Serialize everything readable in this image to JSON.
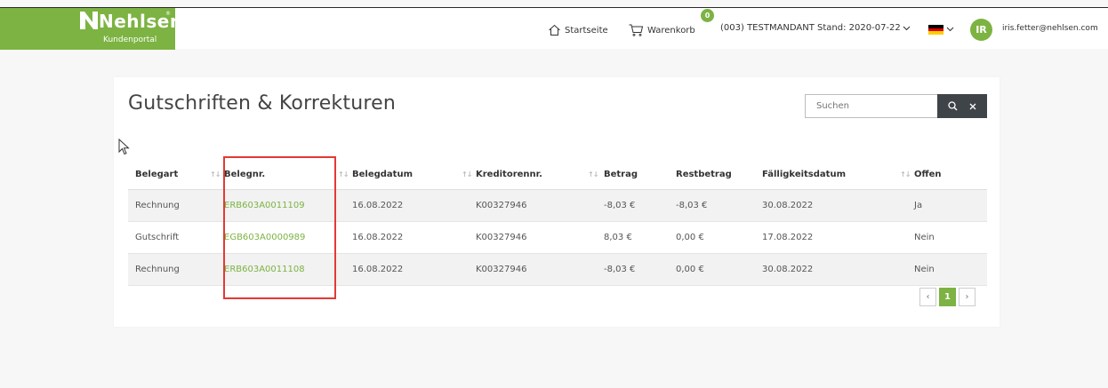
{
  "header": {
    "logo_text": "Nehlsen",
    "logo_reg": "®",
    "logo_subtitle": "Kundenportal",
    "nav_home": "Startseite",
    "nav_cart": "Warenkorb",
    "cart_count": "0",
    "tenant": "(003) TESTMANDANT Stand: 2020-07-22",
    "language": "de",
    "avatar_initials": "IR",
    "user_email": "iris.fetter@nehlsen.com"
  },
  "page": {
    "title": "Gutschriften & Korrekturen",
    "search_placeholder": "Suchen",
    "search_icon": "search-icon",
    "clear_icon": "close-icon"
  },
  "table": {
    "headers": [
      "Belegart",
      "Belegnr.",
      "Belegdatum",
      "Kreditorennr.",
      "Betrag",
      "Restbetrag",
      "Fälligkeitsdatum",
      "Offen"
    ],
    "rows": [
      [
        "Rechnung",
        "ERB603A0011109",
        "16.08.2022",
        "K00327946",
        "-8,03 €",
        "-8,03 €",
        "30.08.2022",
        "Ja"
      ],
      [
        "Gutschrift",
        "EGB603A0000989",
        "16.08.2022",
        "K00327946",
        "8,03 €",
        "0,00 €",
        "17.08.2022",
        "Nein"
      ],
      [
        "Rechnung",
        "ERB603A0011108",
        "16.08.2022",
        "K00327946",
        "-8,03 €",
        "0,00 €",
        "30.08.2022",
        "Nein"
      ]
    ]
  },
  "pagination": {
    "prev": "‹",
    "current": "1",
    "next": "›"
  },
  "colors": {
    "brand_green": "#7cb342",
    "highlight_red": "#e53935",
    "search_button": "#3f4449"
  }
}
